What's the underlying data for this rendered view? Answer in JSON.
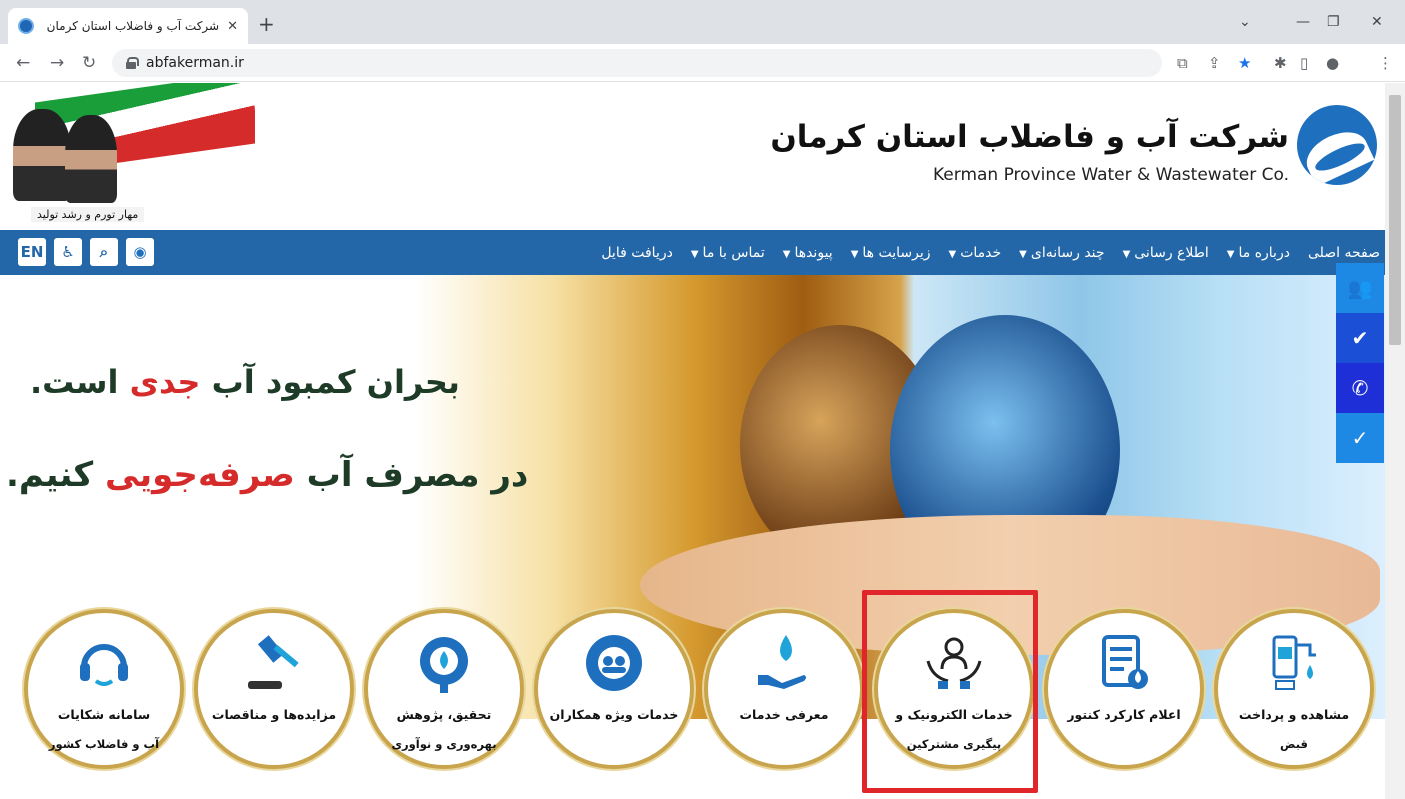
{
  "browser": {
    "tab_title": "شرکت آب و فاضلاب استان کرمان",
    "url": "abfakerman.ir"
  },
  "header": {
    "brand_fa": "شرکت آب و فاضلاب استان کرمان",
    "brand_en": "Kerman Province Water & Wastewater Co.",
    "slogan": "مهار تورم و رشد تولید"
  },
  "nav": {
    "items": [
      {
        "label": "صفحه اصلی",
        "dropdown": false
      },
      {
        "label": "درباره ما",
        "dropdown": true
      },
      {
        "label": "اطلاع رسانی",
        "dropdown": true
      },
      {
        "label": "چند رسانه‌ای",
        "dropdown": true
      },
      {
        "label": "خدمات",
        "dropdown": true
      },
      {
        "label": "زیرسایت ها",
        "dropdown": true
      },
      {
        "label": "پیوندها",
        "dropdown": true
      },
      {
        "label": "تماس با ما",
        "dropdown": true
      },
      {
        "label": "دریافت فایل",
        "dropdown": false
      }
    ],
    "en_label": "EN"
  },
  "hero": {
    "line1_pre": "بحران کمبود آب ",
    "line1_accent": "جدی",
    "line1_post": " است.",
    "line2_pre": "در مصرف آب ",
    "line2_accent": "صرفه‌جویی",
    "line2_post": " کنیم."
  },
  "floatbar": {
    "items": [
      {
        "icon": "users-icon",
        "color": "#1e88e5"
      },
      {
        "icon": "double-check-icon",
        "color": "#1a4fd6"
      },
      {
        "icon": "phone-icon",
        "color": "#1f2fd8"
      },
      {
        "icon": "user-check-icon",
        "color": "#1e88e5"
      }
    ]
  },
  "services": [
    {
      "line1": "سامانه شکایات",
      "line2": "آب و فاضلاب کشور",
      "icon": "headset-icon"
    },
    {
      "line1": "مزایده‌ها و مناقصات",
      "line2": "",
      "icon": "gavel-icon"
    },
    {
      "line1": "تحقیق، پژوهش",
      "line2": "بهره‌وری و نوآوری",
      "icon": "research-gear-icon"
    },
    {
      "line1": "خدمات ویژه همکاران",
      "line2": "",
      "icon": "team-gear-icon"
    },
    {
      "line1": "معرفی خدمات",
      "line2": "",
      "icon": "hand-drop-icon"
    },
    {
      "line1": "خدمات الکترونیک و",
      "line2": "پیگیری مشترکین",
      "icon": "hands-person-icon"
    },
    {
      "line1": "اعلام کارکرد کنتور",
      "line2": "",
      "icon": "meter-document-icon"
    },
    {
      "line1": "مشاهده و پرداخت",
      "line2": "قبض",
      "icon": "bill-payment-icon"
    }
  ],
  "colors": {
    "nav_bg": "#2467a8",
    "accent_red": "#d62b2b",
    "gold_ring": "#c8a54d",
    "icon_blue": "#1f6fbf"
  }
}
